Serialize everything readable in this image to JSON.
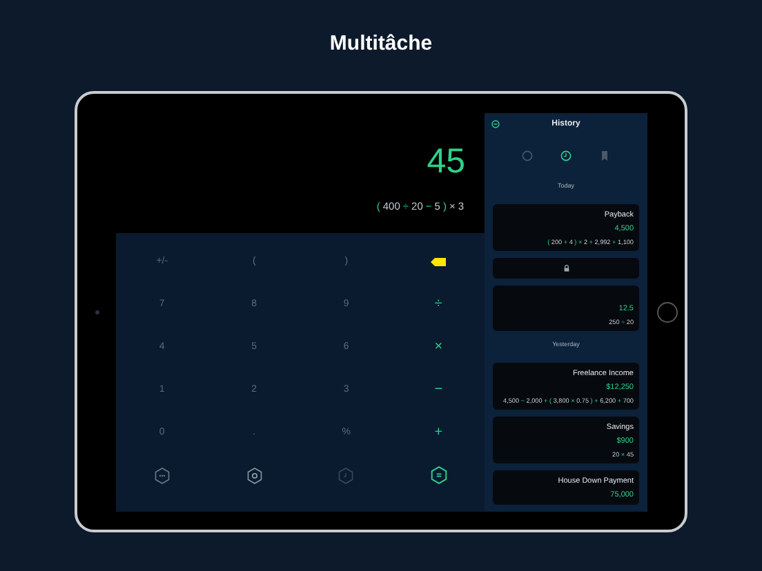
{
  "headline": "Multitâche",
  "display": {
    "result": "45",
    "expression": [
      {
        "text": "(",
        "kind": "operator"
      },
      {
        "text": "400",
        "kind": "number"
      },
      {
        "text": "÷",
        "kind": "operator"
      },
      {
        "text": "20",
        "kind": "number"
      },
      {
        "text": "−",
        "kind": "operator"
      },
      {
        "text": "5",
        "kind": "number"
      },
      {
        "text": ")",
        "kind": "operator"
      },
      {
        "text": "×",
        "kind": "number"
      },
      {
        "text": "3",
        "kind": "number"
      }
    ]
  },
  "keys": [
    {
      "label": "+/-",
      "kind": "digit"
    },
    {
      "label": "(",
      "kind": "digit"
    },
    {
      "label": ")",
      "kind": "digit"
    },
    {
      "kind": "delete"
    },
    {
      "label": "7",
      "kind": "digit"
    },
    {
      "label": "8",
      "kind": "digit"
    },
    {
      "label": "9",
      "kind": "digit"
    },
    {
      "label": "÷",
      "kind": "operator"
    },
    {
      "label": "4",
      "kind": "digit"
    },
    {
      "label": "5",
      "kind": "digit"
    },
    {
      "label": "6",
      "kind": "digit"
    },
    {
      "label": "×",
      "kind": "operator"
    },
    {
      "label": "1",
      "kind": "digit"
    },
    {
      "label": "2",
      "kind": "digit"
    },
    {
      "label": "3",
      "kind": "digit"
    },
    {
      "label": "−",
      "kind": "operator"
    },
    {
      "label": "0",
      "kind": "digit"
    },
    {
      "label": ".",
      "kind": "digit"
    },
    {
      "label": "%",
      "kind": "digit"
    },
    {
      "label": "+",
      "kind": "operator"
    },
    {
      "kind": "more"
    },
    {
      "kind": "settings"
    },
    {
      "kind": "history"
    },
    {
      "kind": "equals"
    }
  ],
  "history": {
    "title": "History",
    "tabs": [
      {
        "kind": "circle",
        "selected": false
      },
      {
        "kind": "clock",
        "selected": true
      },
      {
        "kind": "bookmark",
        "selected": false
      }
    ],
    "groups": [
      {
        "label": "Today",
        "entries": [
          {
            "title": "Payback",
            "result": "4,500",
            "expression": "( 200 + 4 ) × 2 + 2,992 + 1,100",
            "locked": false
          },
          {
            "locked": true
          },
          {
            "result": "12.5",
            "expression": "250 ÷ 20",
            "locked": false
          }
        ]
      },
      {
        "label": "Yesterday",
        "entries": [
          {
            "title": "Freelance Income",
            "result": "$12,250",
            "expression": "4,500 − 2,000 + ( 3,800 × 0.75 ) + 6,200 + 700",
            "locked": false
          },
          {
            "title": "Savings",
            "result": "$900",
            "expression": "20 × 45",
            "locked": false
          },
          {
            "title": "House Down Payment",
            "result": "75,000",
            "locked": false
          }
        ]
      }
    ]
  }
}
